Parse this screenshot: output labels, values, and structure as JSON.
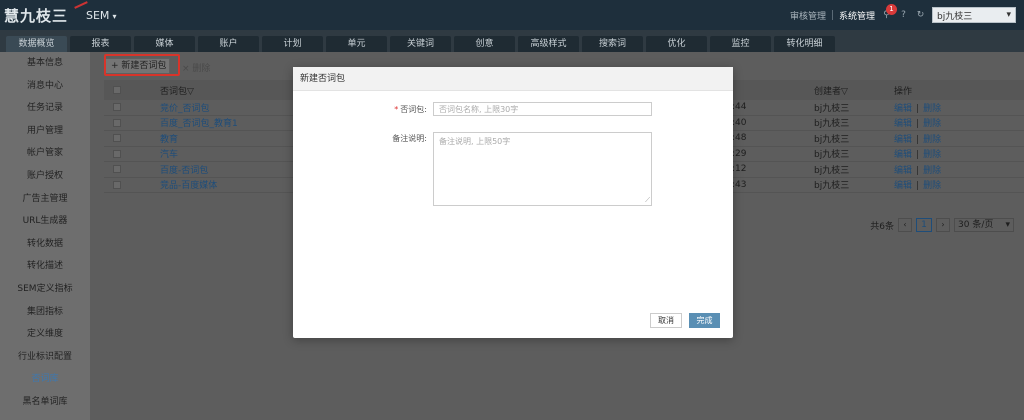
{
  "header": {
    "logo": "慧九枝三",
    "product": "SEM",
    "links": [
      "审核管理",
      "系统管理"
    ],
    "badge_count": "1",
    "account": "bj九枝三"
  },
  "tabs": [
    "数据概览",
    "报表",
    "媒体",
    "账户",
    "计划",
    "单元",
    "关键词",
    "创意",
    "高级样式",
    "搜索词",
    "优化",
    "监控",
    "转化明细"
  ],
  "sidebar": [
    "基本信息",
    "消息中心",
    "任务记录",
    "用户管理",
    "帐户管家",
    "账户授权",
    "广告主管理",
    "URL生成器",
    "转化数据",
    "转化描述",
    "SEM定义指标",
    "集团指标",
    "定义维度",
    "行业标识配置",
    "否词库",
    "黑名单词库"
  ],
  "sidebar_active": 14,
  "toolbar": {
    "new_label": "+ 新建否词包",
    "delete_label": "× 删除"
  },
  "table": {
    "headers": {
      "name": "否词包▽",
      "creator": "创建者▽",
      "op": "操作"
    },
    "rows": [
      {
        "name": "竞价_否词包",
        "time": "11:43:44",
        "creator": "bj九枝三"
      },
      {
        "name": "百度_否词包_教育1",
        "time": "11:45:40",
        "creator": "bj九枝三"
      },
      {
        "name": "教育",
        "time": "14:12:48",
        "creator": "bj九枝三"
      },
      {
        "name": "汽车",
        "time": "15:15:29",
        "creator": "bj九枝三"
      },
      {
        "name": "百度-否词包",
        "time": "14:10:12",
        "creator": "bj九枝三"
      },
      {
        "name": "竞品-百度媒体",
        "time": "17:06:43",
        "creator": "bj九枝三"
      }
    ],
    "edit": "编辑",
    "delete": "删除"
  },
  "pager": {
    "total": "共6条",
    "current": "1",
    "page_size": "30 条/页"
  },
  "modal": {
    "title": "新建否词包",
    "name_label": "否词包:",
    "name_placeholder": "否词包名称, 上限30字",
    "note_label": "备注说明:",
    "note_placeholder": "备注说明, 上限50字",
    "cancel": "取消",
    "ok": "完成"
  }
}
